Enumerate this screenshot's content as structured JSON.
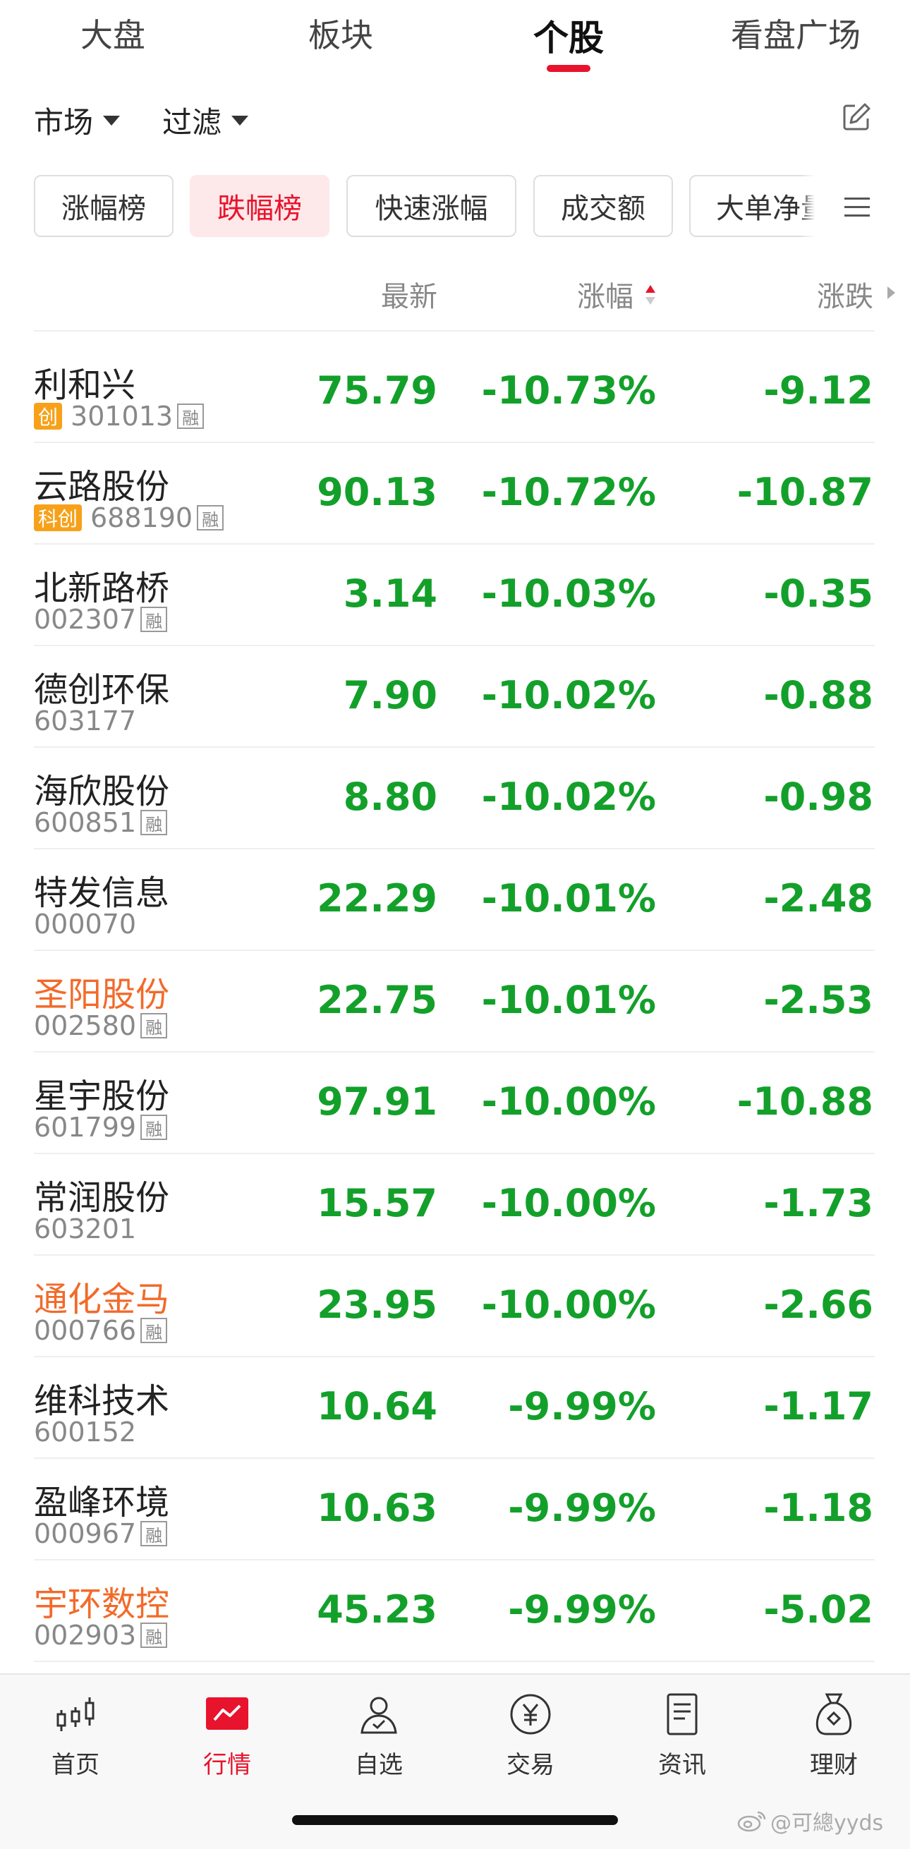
{
  "top_tabs": [
    "大盘",
    "板块",
    "个股",
    "看盘广场"
  ],
  "filters": {
    "market": "市场",
    "filter": "过滤"
  },
  "chips": [
    "涨幅榜",
    "跌幅榜",
    "快速涨幅",
    "成交额",
    "大单净量"
  ],
  "columns": {
    "latest": "最新",
    "pct": "涨幅",
    "change": "涨跌"
  },
  "stocks": [
    {
      "name": "利和兴",
      "code": "301013",
      "badge": "创",
      "rong": "融",
      "price": "75.79",
      "pct": "-10.73%",
      "change": "-9.12"
    },
    {
      "name": "云路股份",
      "code": "688190",
      "badge": "科创",
      "rong": "融",
      "price": "90.13",
      "pct": "-10.72%",
      "change": "-10.87"
    },
    {
      "name": "北新路桥",
      "code": "002307",
      "badge": "",
      "rong": "融",
      "price": "3.14",
      "pct": "-10.03%",
      "change": "-0.35"
    },
    {
      "name": "德创环保",
      "code": "603177",
      "badge": "",
      "rong": "",
      "price": "7.90",
      "pct": "-10.02%",
      "change": "-0.88"
    },
    {
      "name": "海欣股份",
      "code": "600851",
      "badge": "",
      "rong": "融",
      "price": "8.80",
      "pct": "-10.02%",
      "change": "-0.98"
    },
    {
      "name": "特发信息",
      "code": "000070",
      "badge": "",
      "rong": "",
      "price": "22.29",
      "pct": "-10.01%",
      "change": "-2.48"
    },
    {
      "name": "圣阳股份",
      "code": "002580",
      "badge": "",
      "rong": "融",
      "price": "22.75",
      "pct": "-10.01%",
      "change": "-2.53"
    },
    {
      "name": "星宇股份",
      "code": "601799",
      "badge": "",
      "rong": "融",
      "price": "97.91",
      "pct": "-10.00%",
      "change": "-10.88"
    },
    {
      "name": "常润股份",
      "code": "603201",
      "badge": "",
      "rong": "",
      "price": "15.57",
      "pct": "-10.00%",
      "change": "-1.73"
    },
    {
      "name": "通化金马",
      "code": "000766",
      "badge": "",
      "rong": "融",
      "price": "23.95",
      "pct": "-10.00%",
      "change": "-2.66"
    },
    {
      "name": "维科技术",
      "code": "600152",
      "badge": "",
      "rong": "",
      "price": "10.64",
      "pct": "-9.99%",
      "change": "-1.17"
    },
    {
      "name": "盈峰环境",
      "code": "000967",
      "badge": "",
      "rong": "融",
      "price": "10.63",
      "pct": "-9.99%",
      "change": "-1.18"
    },
    {
      "name": "宇环数控",
      "code": "002903",
      "badge": "",
      "rong": "融",
      "price": "45.23",
      "pct": "-9.99%",
      "change": "-5.02"
    }
  ],
  "bottom_tabs": [
    "首页",
    "行情",
    "自选",
    "交易",
    "资讯",
    "理财"
  ],
  "watermark": "@可總yyds",
  "colors": {
    "accent": "#e8132c",
    "down": "#13a02a",
    "highlight_name": "#f26a2a",
    "badge": "#f7a11a"
  }
}
